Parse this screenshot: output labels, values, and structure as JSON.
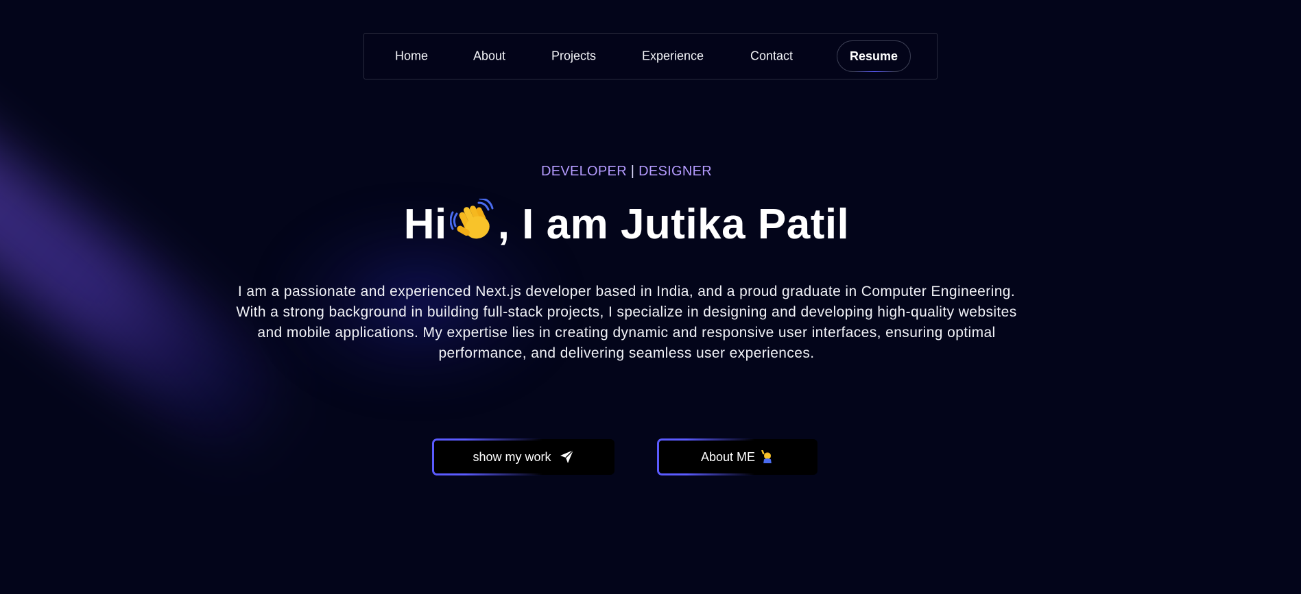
{
  "nav": {
    "items": [
      {
        "label": "Home"
      },
      {
        "label": "About"
      },
      {
        "label": "Projects"
      },
      {
        "label": "Experience"
      },
      {
        "label": "Contact"
      }
    ],
    "resume_label": "Resume"
  },
  "hero": {
    "role_1": "DEVELOPER",
    "separator": "|",
    "role_2": "DESIGNER",
    "greeting": "Hi",
    "name_text": ", I am Jutika Patil",
    "intro": "I am a passionate and experienced Next.js developer based in India, and a proud graduate in Computer Engineering. With a strong background in building full-stack projects, I specialize in designing and developing high-quality websites and mobile applications. My expertise lies in creating dynamic and responsive user interfaces, ensuring optimal performance, and delivering seamless user experiences."
  },
  "actions": {
    "work_label": "show my work",
    "work_icon": "paper-plane-icon",
    "about_label": "About ME",
    "about_icon": "person-raising-hand-icon"
  },
  "colors": {
    "background": "#03051a",
    "accent": "#5b5bff",
    "role_text": "#b59cff",
    "beam": "#6e50d2"
  }
}
